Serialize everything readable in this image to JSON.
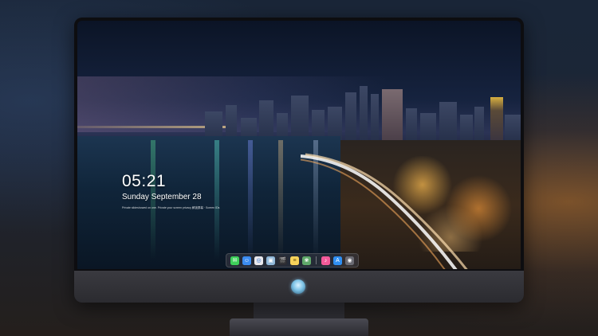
{
  "lock_screen": {
    "time": "05:21",
    "date": "Sunday September  28",
    "hint": "Private slideshowed on one. Private your screen privacy 解锁屏幕 · Screen IDs"
  },
  "dock": {
    "apps": [
      {
        "name": "messages-icon",
        "color": "#3ecf5a",
        "glyph": "✉"
      },
      {
        "name": "finder-icon",
        "color": "#3b8cf0",
        "glyph": "☺"
      },
      {
        "name": "safari-icon",
        "color": "#e8e8ec",
        "glyph": "◎"
      },
      {
        "name": "preview-icon",
        "color": "#8fb7d8",
        "glyph": "▣"
      },
      {
        "name": "clapper-icon",
        "color": "#2c2c32",
        "glyph": "🎬"
      },
      {
        "name": "notes-icon",
        "color": "#f6d25a",
        "glyph": "≡"
      },
      {
        "name": "photos-icon",
        "color": "#5fa86a",
        "glyph": "❀"
      },
      {
        "name": "music-icon",
        "color": "#f25a9a",
        "glyph": "♪"
      },
      {
        "name": "app-store-icon",
        "color": "#2f8ff2",
        "glyph": "A"
      },
      {
        "name": "camera-icon",
        "color": "#6a6a72",
        "glyph": "◉"
      }
    ]
  },
  "colors": {
    "accent_text": "#ffffff",
    "dock_background": "rgba(60,60,70,0.55)"
  }
}
